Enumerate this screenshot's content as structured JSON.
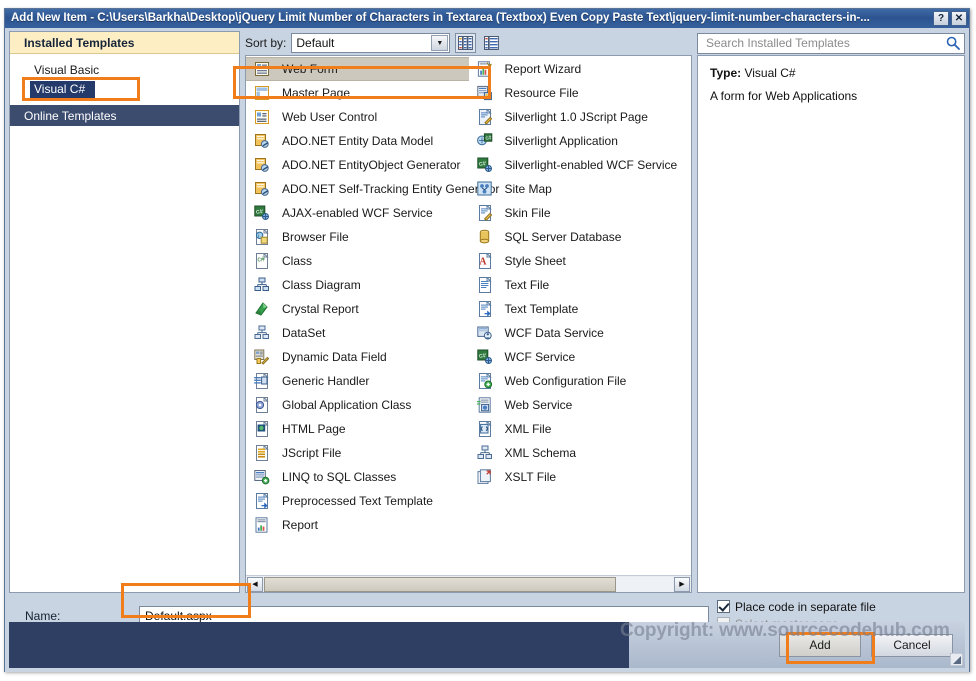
{
  "window": {
    "title": "Add New Item - C:\\Users\\Barkha\\Desktop\\jQuery Limit Number of Characters in Textarea (Textbox) Even Copy Paste Text\\jquery-limit-number-characters-in-...",
    "help_label": "?",
    "close_label": "✕"
  },
  "sidebar": {
    "header": "Installed Templates",
    "items": [
      {
        "label": "Visual Basic",
        "selected": false
      },
      {
        "label": "Visual C#",
        "selected": true
      }
    ],
    "group_label": "Online Templates"
  },
  "toolbar": {
    "sort_label": "Sort by:",
    "sort_value": "Default",
    "view_medium_icons": "medium-icons-view",
    "view_list": "list-view"
  },
  "search": {
    "placeholder": "Search Installed Templates",
    "value": "",
    "icon": "search-icon"
  },
  "details": {
    "type_label": "Type:",
    "type_value": "Visual C#",
    "description": "A form for Web Applications"
  },
  "templates": {
    "left_column": [
      {
        "label": "Web Form",
        "icon": "web-form-icon",
        "selected": true
      },
      {
        "label": "Master Page",
        "icon": "master-page-icon",
        "selected": false
      },
      {
        "label": "Web User Control",
        "icon": "web-user-control-icon",
        "selected": false
      },
      {
        "label": "ADO.NET Entity Data Model",
        "icon": "ado-net-entity-icon",
        "selected": false
      },
      {
        "label": "ADO.NET EntityObject Generator",
        "icon": "ado-net-entity-icon",
        "selected": false
      },
      {
        "label": "ADO.NET Self-Tracking Entity Generator",
        "icon": "ado-net-entity-icon",
        "selected": false
      },
      {
        "label": "AJAX-enabled WCF Service",
        "icon": "wcf-service-icon",
        "selected": false
      },
      {
        "label": "Browser File",
        "icon": "browser-file-icon",
        "selected": false
      },
      {
        "label": "Class",
        "icon": "class-icon",
        "selected": false
      },
      {
        "label": "Class Diagram",
        "icon": "class-diagram-icon",
        "selected": false
      },
      {
        "label": "Crystal Report",
        "icon": "crystal-report-icon",
        "selected": false
      },
      {
        "label": "DataSet",
        "icon": "dataset-icon",
        "selected": false
      },
      {
        "label": "Dynamic Data Field",
        "icon": "dynamic-data-field-icon",
        "selected": false
      },
      {
        "label": "Generic Handler",
        "icon": "generic-handler-icon",
        "selected": false
      },
      {
        "label": "Global Application Class",
        "icon": "global-application-class-icon",
        "selected": false
      },
      {
        "label": "HTML Page",
        "icon": "html-page-icon",
        "selected": false
      },
      {
        "label": "JScript File",
        "icon": "jscript-file-icon",
        "selected": false
      },
      {
        "label": "LINQ to SQL Classes",
        "icon": "linq-sql-icon",
        "selected": false
      },
      {
        "label": "Preprocessed Text Template",
        "icon": "text-template-icon",
        "selected": false
      },
      {
        "label": "Report",
        "icon": "report-icon",
        "selected": false
      }
    ],
    "right_column": [
      {
        "label": "Report Wizard",
        "icon": "report-wizard-icon",
        "selected": false
      },
      {
        "label": "Resource File",
        "icon": "resource-file-icon",
        "selected": false
      },
      {
        "label": "Silverlight 1.0 JScript Page",
        "icon": "silverlight-jscript-icon",
        "selected": false
      },
      {
        "label": "Silverlight Application",
        "icon": "silverlight-app-icon",
        "selected": false
      },
      {
        "label": "Silverlight-enabled WCF Service",
        "icon": "wcf-service-icon",
        "selected": false
      },
      {
        "label": "Site Map",
        "icon": "site-map-icon",
        "selected": false
      },
      {
        "label": "Skin File",
        "icon": "skin-file-icon",
        "selected": false
      },
      {
        "label": "SQL Server Database",
        "icon": "sql-server-database-icon",
        "selected": false
      },
      {
        "label": "Style Sheet",
        "icon": "style-sheet-icon",
        "selected": false
      },
      {
        "label": "Text File",
        "icon": "text-file-icon",
        "selected": false
      },
      {
        "label": "Text Template",
        "icon": "text-template-icon",
        "selected": false
      },
      {
        "label": "WCF Data Service",
        "icon": "wcf-data-service-icon",
        "selected": false
      },
      {
        "label": "WCF Service",
        "icon": "wcf-service-icon",
        "selected": false
      },
      {
        "label": "Web Configuration File",
        "icon": "web-config-icon",
        "selected": false
      },
      {
        "label": "Web Service",
        "icon": "web-service-icon",
        "selected": false
      },
      {
        "label": "XML File",
        "icon": "xml-file-icon",
        "selected": false
      },
      {
        "label": "XML Schema",
        "icon": "xml-schema-icon",
        "selected": false
      },
      {
        "label": "XSLT File",
        "icon": "xslt-file-icon",
        "selected": false
      }
    ]
  },
  "name_field": {
    "label": "Name:",
    "value": "Default.aspx"
  },
  "options": [
    {
      "label": "Place code in separate file",
      "checked": true,
      "disabled": false
    },
    {
      "label": "Select master page",
      "checked": false,
      "disabled": true
    }
  ],
  "buttons": {
    "add": "Add",
    "cancel": "Cancel"
  },
  "watermark": "Copyright: www.sourcecodehub.com",
  "colors": {
    "titlebar": "#2c5490",
    "accent_orange": "#f07d1a",
    "sidebar_header": "#fdeec3",
    "group_navy": "#3c4c6e",
    "selection_tan": "#cdc8bd",
    "footer_navy": "#2f3f63"
  }
}
